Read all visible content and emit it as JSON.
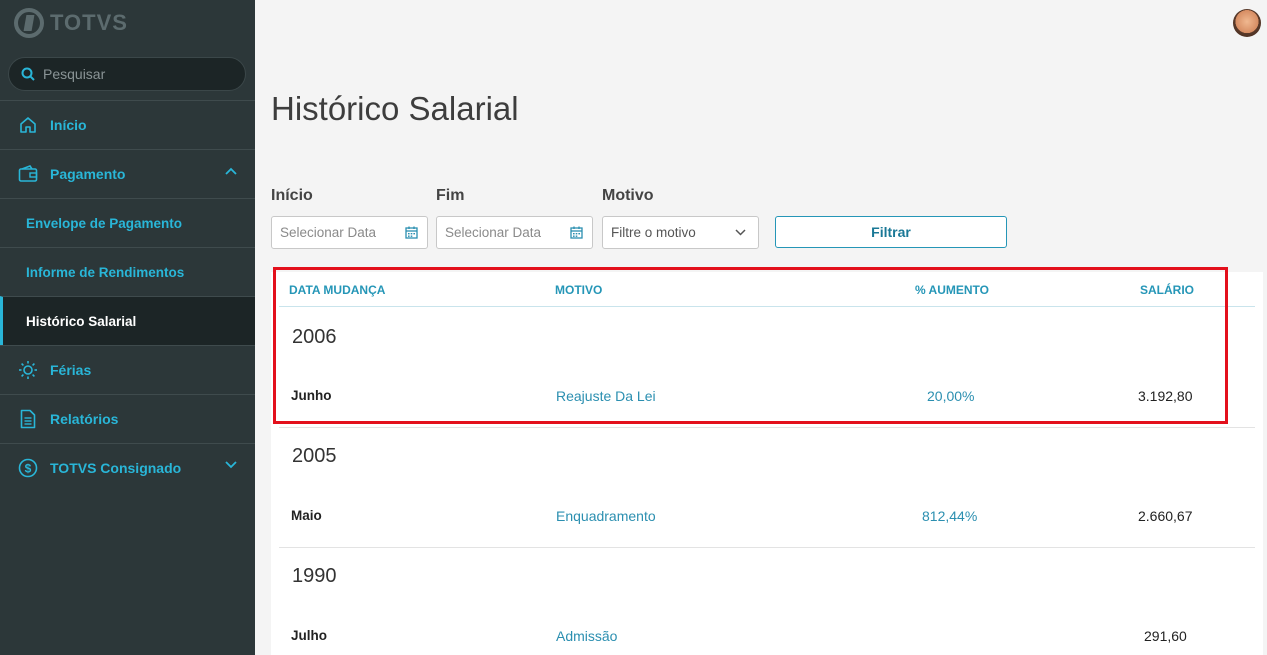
{
  "app": {
    "brand": "TOTVS"
  },
  "search": {
    "placeholder": "Pesquisar"
  },
  "sidebar": {
    "items": [
      {
        "label": "Início",
        "icon": "home-icon"
      },
      {
        "label": "Pagamento",
        "icon": "wallet-icon",
        "expanded": true
      },
      {
        "label": "Envelope de Pagamento"
      },
      {
        "label": "Informe de Rendimentos"
      },
      {
        "label": "Histórico Salarial",
        "active": true
      },
      {
        "label": "Férias",
        "icon": "sun-icon"
      },
      {
        "label": "Relatórios",
        "icon": "document-icon"
      },
      {
        "label": "TOTVS Consignado",
        "icon": "dollar-circle-icon",
        "expanded": false
      }
    ]
  },
  "main": {
    "title": "Histórico Salarial",
    "filters": {
      "start_label": "Início",
      "start_placeholder": "Selecionar Data",
      "end_label": "Fim",
      "end_placeholder": "Selecionar Data",
      "motivo_label": "Motivo",
      "motivo_value": "Filtre o motivo",
      "filter_button": "Filtrar"
    },
    "table": {
      "headers": [
        "DATA MUDANÇA",
        "MOTIVO",
        "% AUMENTO",
        "SALÁRIO"
      ],
      "groups": [
        {
          "year": "2006",
          "rows": [
            {
              "month": "Junho",
              "motivo": "Reajuste Da Lei",
              "aumento": "20,00%",
              "salario": "3.192,80"
            }
          ]
        },
        {
          "year": "2005",
          "rows": [
            {
              "month": "Maio",
              "motivo": "Enquadramento",
              "aumento": "812,44%",
              "salario": "2.660,67"
            }
          ]
        },
        {
          "year": "1990",
          "rows": [
            {
              "month": "Julho",
              "motivo": "Admissão",
              "aumento": "",
              "salario": "291,60"
            }
          ]
        }
      ]
    }
  },
  "colors": {
    "accent": "#29b6d8",
    "sidebar_bg": "#2c3739",
    "highlight": "#e3101c"
  }
}
